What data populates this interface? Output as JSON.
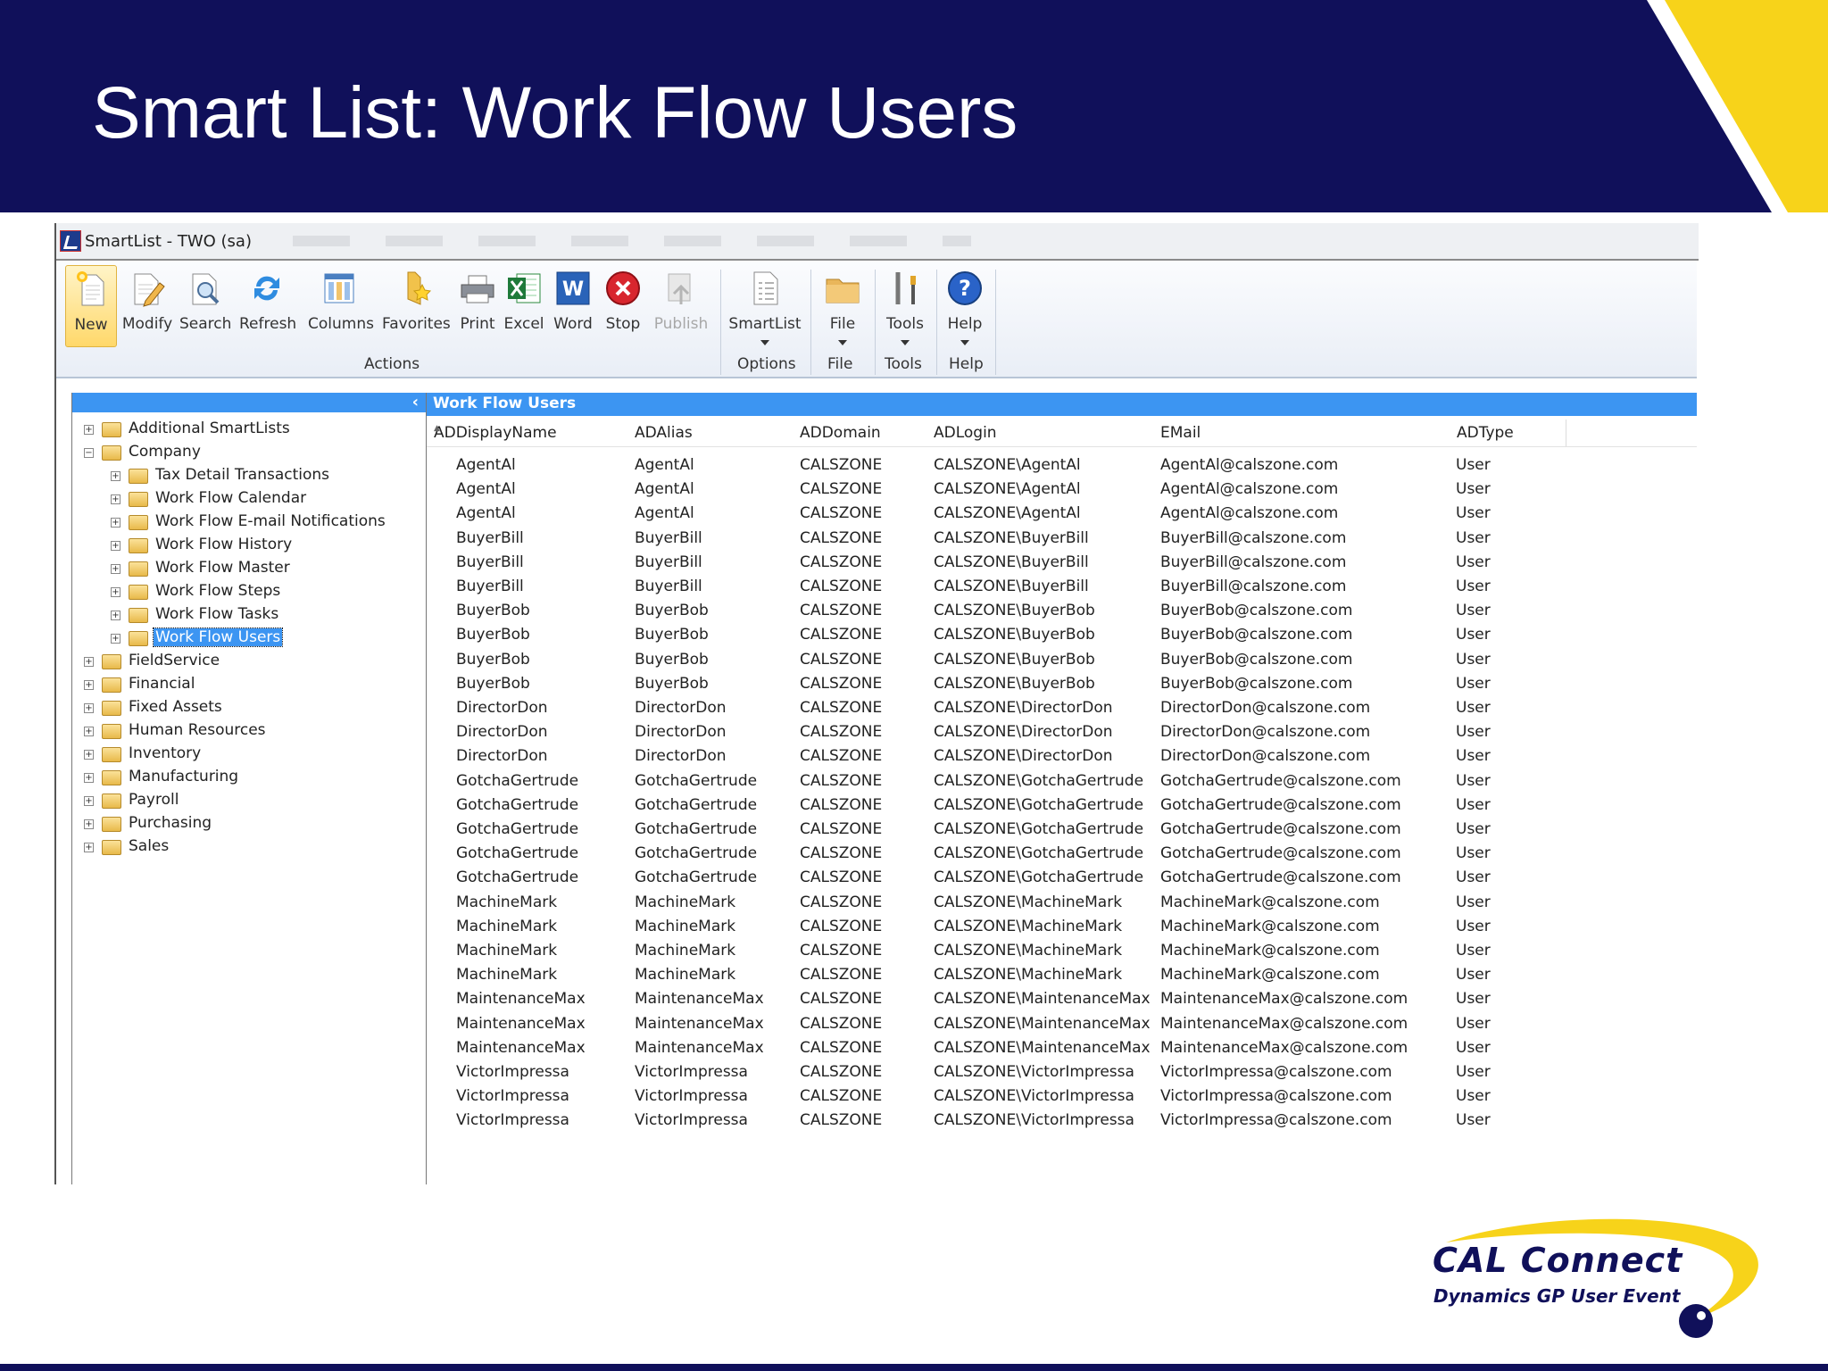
{
  "slide": {
    "title": "Smart List: Work Flow Users",
    "colors": {
      "banner": "#10105a",
      "accent": "#f7d31a",
      "selection": "#3c95f2"
    }
  },
  "window": {
    "title": "SmartList  -  TWO (sa)"
  },
  "ribbon": {
    "buttons": [
      {
        "label": "New",
        "icon": "new-document-icon"
      },
      {
        "label": "Modify",
        "icon": "pencil-document-icon"
      },
      {
        "label": "Search",
        "icon": "magnifier-document-icon"
      },
      {
        "label": "Refresh",
        "icon": "refresh-arrows-icon"
      },
      {
        "label": "Columns",
        "icon": "columns-icon"
      },
      {
        "label": "Favorites",
        "icon": "folder-star-icon"
      },
      {
        "label": "Print",
        "icon": "printer-icon"
      },
      {
        "label": "Excel",
        "icon": "excel-icon"
      },
      {
        "label": "Word",
        "icon": "word-icon"
      },
      {
        "label": "Stop",
        "icon": "stop-icon"
      },
      {
        "label": "Publish",
        "icon": "publish-icon"
      },
      {
        "label": "SmartList",
        "icon": "list-document-icon"
      },
      {
        "label": "File",
        "icon": "folder-icon"
      },
      {
        "label": "Tools",
        "icon": "tools-icon"
      },
      {
        "label": "Help",
        "icon": "help-icon"
      }
    ],
    "groups": [
      "Actions",
      "Options",
      "File",
      "Tools",
      "Help"
    ]
  },
  "tree": {
    "collapse_glyph": "‹",
    "items": [
      "Additional SmartLists",
      "Company",
      "Tax Detail Transactions",
      "Work Flow Calendar",
      "Work Flow E-mail Notifications",
      "Work Flow History",
      "Work Flow Master",
      "Work Flow Steps",
      "Work Flow Tasks",
      "Work Flow Users",
      "FieldService",
      "Financial",
      "Fixed Assets",
      "Human Resources",
      "Inventory",
      "Manufacturing",
      "Payroll",
      "Purchasing",
      "Sales"
    ]
  },
  "list": {
    "title": "Work Flow Users",
    "columns": [
      "ADDisplayName",
      "ADAlias",
      "ADDomain",
      "ADLogin",
      "EMail",
      "ADType"
    ],
    "rows": [
      [
        "AgentAl",
        "AgentAl",
        "CALSZONE",
        "CALSZONE\\AgentAl",
        "AgentAl@calszone.com",
        "User"
      ],
      [
        "AgentAl",
        "AgentAl",
        "CALSZONE",
        "CALSZONE\\AgentAl",
        "AgentAl@calszone.com",
        "User"
      ],
      [
        "AgentAl",
        "AgentAl",
        "CALSZONE",
        "CALSZONE\\AgentAl",
        "AgentAl@calszone.com",
        "User"
      ],
      [
        "BuyerBill",
        "BuyerBill",
        "CALSZONE",
        "CALSZONE\\BuyerBill",
        "BuyerBill@calszone.com",
        "User"
      ],
      [
        "BuyerBill",
        "BuyerBill",
        "CALSZONE",
        "CALSZONE\\BuyerBill",
        "BuyerBill@calszone.com",
        "User"
      ],
      [
        "BuyerBill",
        "BuyerBill",
        "CALSZONE",
        "CALSZONE\\BuyerBill",
        "BuyerBill@calszone.com",
        "User"
      ],
      [
        "BuyerBob",
        "BuyerBob",
        "CALSZONE",
        "CALSZONE\\BuyerBob",
        "BuyerBob@calszone.com",
        "User"
      ],
      [
        "BuyerBob",
        "BuyerBob",
        "CALSZONE",
        "CALSZONE\\BuyerBob",
        "BuyerBob@calszone.com",
        "User"
      ],
      [
        "BuyerBob",
        "BuyerBob",
        "CALSZONE",
        "CALSZONE\\BuyerBob",
        "BuyerBob@calszone.com",
        "User"
      ],
      [
        "BuyerBob",
        "BuyerBob",
        "CALSZONE",
        "CALSZONE\\BuyerBob",
        "BuyerBob@calszone.com",
        "User"
      ],
      [
        "DirectorDon",
        "DirectorDon",
        "CALSZONE",
        "CALSZONE\\DirectorDon",
        "DirectorDon@calszone.com",
        "User"
      ],
      [
        "DirectorDon",
        "DirectorDon",
        "CALSZONE",
        "CALSZONE\\DirectorDon",
        "DirectorDon@calszone.com",
        "User"
      ],
      [
        "DirectorDon",
        "DirectorDon",
        "CALSZONE",
        "CALSZONE\\DirectorDon",
        "DirectorDon@calszone.com",
        "User"
      ],
      [
        "GotchaGertrude",
        "GotchaGertrude",
        "CALSZONE",
        "CALSZONE\\GotchaGertrude",
        "GotchaGertrude@calszone.com",
        "User"
      ],
      [
        "GotchaGertrude",
        "GotchaGertrude",
        "CALSZONE",
        "CALSZONE\\GotchaGertrude",
        "GotchaGertrude@calszone.com",
        "User"
      ],
      [
        "GotchaGertrude",
        "GotchaGertrude",
        "CALSZONE",
        "CALSZONE\\GotchaGertrude",
        "GotchaGertrude@calszone.com",
        "User"
      ],
      [
        "GotchaGertrude",
        "GotchaGertrude",
        "CALSZONE",
        "CALSZONE\\GotchaGertrude",
        "GotchaGertrude@calszone.com",
        "User"
      ],
      [
        "GotchaGertrude",
        "GotchaGertrude",
        "CALSZONE",
        "CALSZONE\\GotchaGertrude",
        "GotchaGertrude@calszone.com",
        "User"
      ],
      [
        "MachineMark",
        "MachineMark",
        "CALSZONE",
        "CALSZONE\\MachineMark",
        "MachineMark@calszone.com",
        "User"
      ],
      [
        "MachineMark",
        "MachineMark",
        "CALSZONE",
        "CALSZONE\\MachineMark",
        "MachineMark@calszone.com",
        "User"
      ],
      [
        "MachineMark",
        "MachineMark",
        "CALSZONE",
        "CALSZONE\\MachineMark",
        "MachineMark@calszone.com",
        "User"
      ],
      [
        "MachineMark",
        "MachineMark",
        "CALSZONE",
        "CALSZONE\\MachineMark",
        "MachineMark@calszone.com",
        "User"
      ],
      [
        "MaintenanceMax",
        "MaintenanceMax",
        "CALSZONE",
        "CALSZONE\\MaintenanceMax",
        "MaintenanceMax@calszone.com",
        "User"
      ],
      [
        "MaintenanceMax",
        "MaintenanceMax",
        "CALSZONE",
        "CALSZONE\\MaintenanceMax",
        "MaintenanceMax@calszone.com",
        "User"
      ],
      [
        "MaintenanceMax",
        "MaintenanceMax",
        "CALSZONE",
        "CALSZONE\\MaintenanceMax",
        "MaintenanceMax@calszone.com",
        "User"
      ],
      [
        "VictorImpressa",
        "VictorImpressa",
        "CALSZONE",
        "CALSZONE\\VictorImpressa",
        "VictorImpressa@calszone.com",
        "User"
      ],
      [
        "VictorImpressa",
        "VictorImpressa",
        "CALSZONE",
        "CALSZONE\\VictorImpressa",
        "VictorImpressa@calszone.com",
        "User"
      ],
      [
        "VictorImpressa",
        "VictorImpressa",
        "CALSZONE",
        "CALSZONE\\VictorImpressa",
        "VictorImpressa@calszone.com",
        "User"
      ]
    ]
  },
  "logo": {
    "line1": "CAL Connect",
    "line2": "Dynamics GP User Event"
  }
}
